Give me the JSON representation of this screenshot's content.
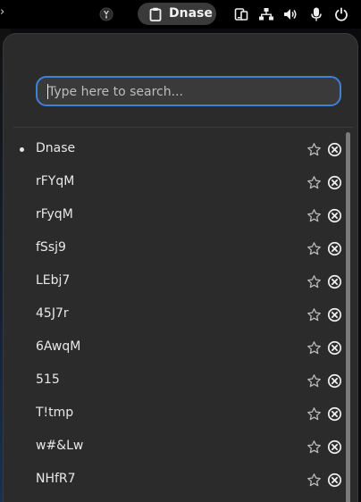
{
  "topbar": {
    "clipboard_label": "Dnase",
    "icons": [
      "app-indicator-icon",
      "clipboard-icon",
      "screen-share-icon",
      "network-wired-icon",
      "volume-icon",
      "microphone-icon",
      "power-icon"
    ]
  },
  "search": {
    "placeholder": "Type here to search..."
  },
  "history": [
    {
      "text": "Dnase",
      "active": true
    },
    {
      "text": "rFYqM",
      "active": false
    },
    {
      "text": "rFyqM",
      "active": false
    },
    {
      "text": "fSsj9",
      "active": false
    },
    {
      "text": "LEbj7",
      "active": false
    },
    {
      "text": "45J7r",
      "active": false
    },
    {
      "text": "6AwqM",
      "active": false
    },
    {
      "text": "515",
      "active": false
    },
    {
      "text": "T!tmp",
      "active": false
    },
    {
      "text": "w#&Lw",
      "active": false
    },
    {
      "text": "NHfR7",
      "active": false
    }
  ],
  "colors": {
    "accent": "#3f80d8",
    "popover_bg": "#2b2b2b",
    "topbar_bg": "#000000"
  }
}
